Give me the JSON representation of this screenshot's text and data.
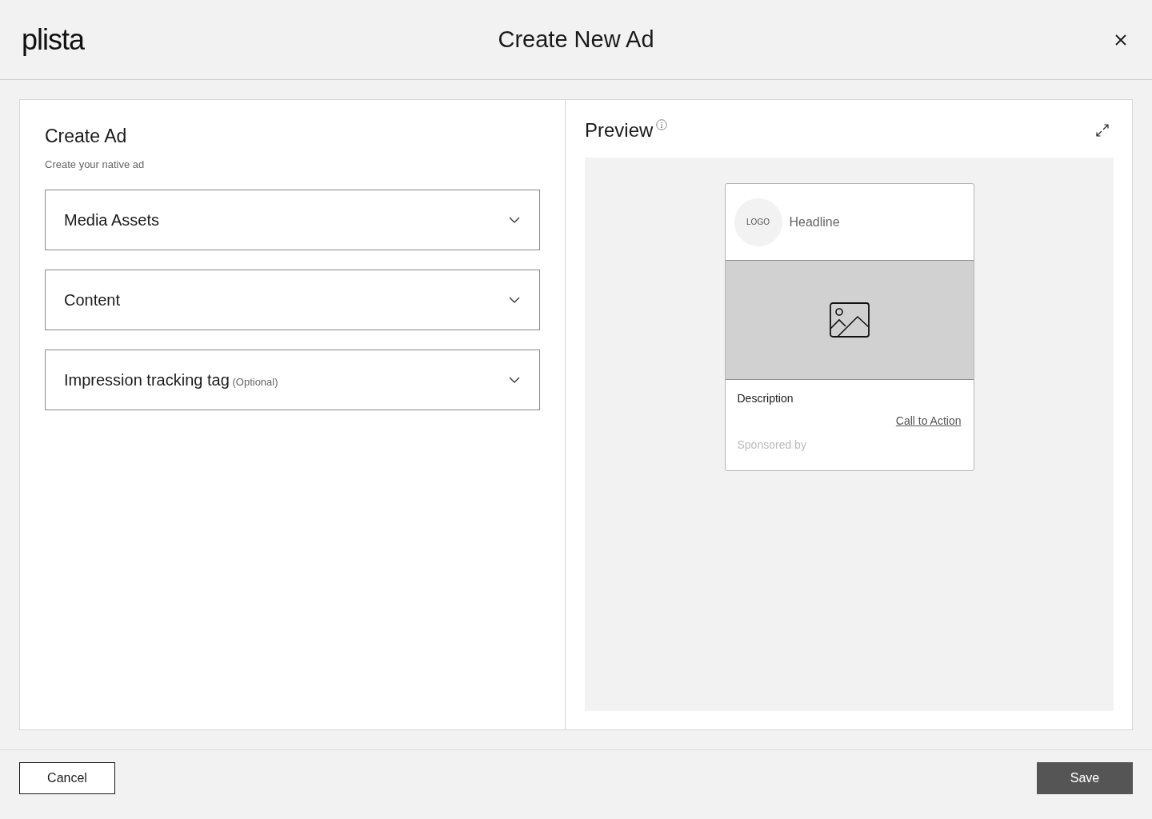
{
  "header": {
    "logo": "plista",
    "title": "Create New Ad"
  },
  "form": {
    "title": "Create Ad",
    "subtitle": "Create your native ad",
    "sections": [
      {
        "label": "Media Assets",
        "expanded": false
      },
      {
        "label": "Content",
        "expanded": false
      },
      {
        "label": "Impression tracking tag",
        "note": "(Optional)",
        "expanded": false
      }
    ]
  },
  "preview": {
    "title": "Preview",
    "ad": {
      "logo": "LOGO",
      "headline": "Headline",
      "description": "Description",
      "call_to_action": "Call to Action",
      "sponsored": "Sponsored by"
    }
  },
  "footer": {
    "buttons": [
      {
        "label": "Cancel",
        "kind": "secondary"
      },
      {
        "label": "Save",
        "kind": "primary"
      }
    ]
  }
}
